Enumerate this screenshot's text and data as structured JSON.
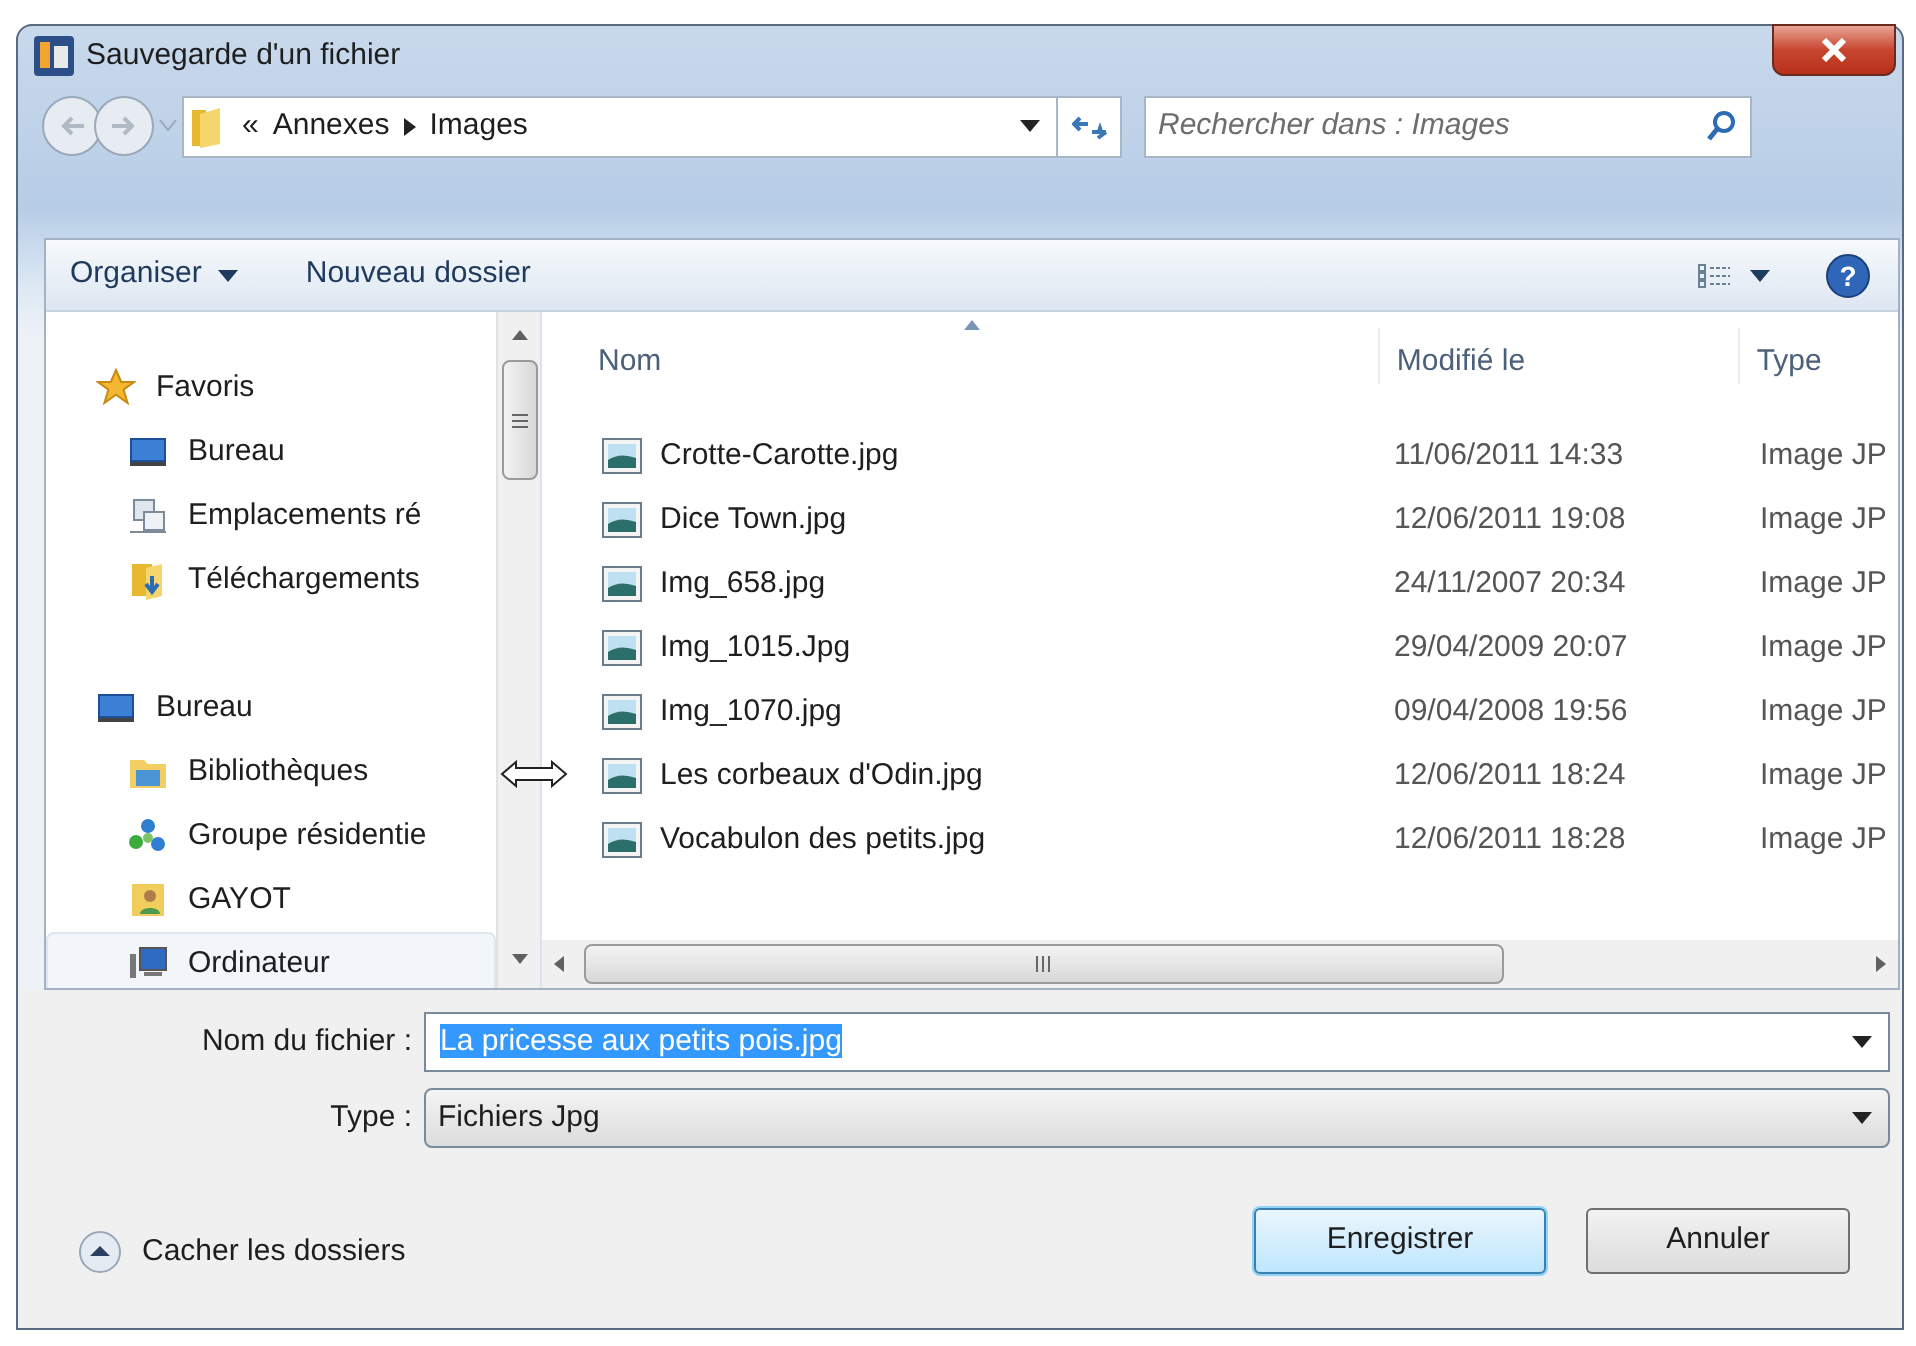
{
  "window": {
    "title": "Sauvegarde d'un fichier"
  },
  "address_bar": {
    "overflow": "«",
    "path": [
      "Annexes",
      "Images"
    ]
  },
  "search": {
    "placeholder": "Rechercher dans : Images"
  },
  "help_button": "?",
  "toolbar": [
    {
      "label": "Organiser",
      "kind": "menu"
    },
    {
      "label": "Nouveau dossier",
      "kind": "button"
    }
  ],
  "navigation": [
    {
      "label": "Favoris",
      "selected": false,
      "children": [
        {
          "label": "Bureau",
          "selected": false
        },
        {
          "label": "Emplacements ré",
          "selected": false
        },
        {
          "label": "Téléchargements",
          "selected": false
        }
      ]
    },
    {
      "label": "Bureau",
      "selected": false,
      "children": [
        {
          "label": "Bibliothèques",
          "selected": false
        },
        {
          "label": "Groupe résidentie",
          "selected": false
        },
        {
          "label": "GAYOT",
          "selected": false
        },
        {
          "label": "Ordinateur",
          "selected": true
        }
      ]
    }
  ],
  "file_list": {
    "columns": [
      {
        "label": "Nom",
        "sorted": true
      },
      {
        "label": "Modifié le",
        "sorted": false
      },
      {
        "label": "Type",
        "sorted": false
      }
    ],
    "rows": [
      {
        "name": "Crotte-Carotte.jpg",
        "modified": "11/06/2011 14:33",
        "type": "Image JP"
      },
      {
        "name": "Dice Town.jpg",
        "modified": "12/06/2011 19:08",
        "type": "Image JP"
      },
      {
        "name": "Img_658.jpg",
        "modified": "24/11/2007 20:34",
        "type": "Image JP"
      },
      {
        "name": "Img_1015.Jpg",
        "modified": "29/04/2009 20:07",
        "type": "Image JP"
      },
      {
        "name": "Img_1070.jpg",
        "modified": "09/04/2008 19:56",
        "type": "Image JP"
      },
      {
        "name": "Les corbeaux d'Odin.jpg",
        "modified": "12/06/2011 18:24",
        "type": "Image JP"
      },
      {
        "name": "Vocabulon des petits.jpg",
        "modified": "12/06/2011 18:28",
        "type": "Image JP"
      }
    ]
  },
  "form": {
    "file_name": {
      "label": "Nom du fichier :",
      "value": "La pricesse aux petits pois.jpg",
      "highlighted": true
    },
    "file_type": {
      "label": "Type :",
      "value": "Fichiers Jpg"
    }
  },
  "hide_folders": "Cacher les dossiers",
  "buttons": [
    {
      "label": "Enregistrer",
      "default": true
    },
    {
      "label": "Annuler",
      "default": false
    }
  ]
}
